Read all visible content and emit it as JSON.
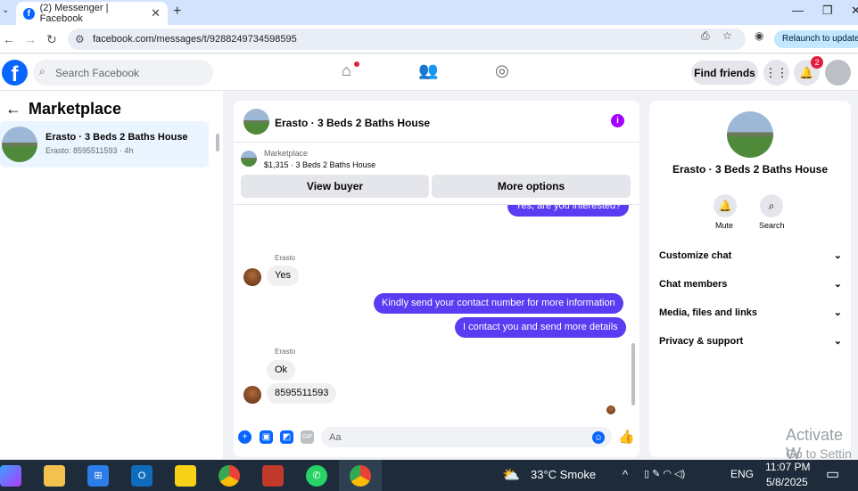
{
  "browser": {
    "tab_title": "(2) Messenger | Facebook",
    "url": "facebook.com/messages/t/9288249734598595",
    "relaunch_label": "Relaunch to update",
    "new_tab": "+",
    "close": "✕"
  },
  "fb": {
    "logo": "f",
    "search_placeholder": "Search Facebook",
    "find_friends": "Find friends",
    "notif_count": "2"
  },
  "left_panel": {
    "title": "Marketplace",
    "back_arrow": "←",
    "conversation": {
      "name": "Erasto · 3 Beds 2 Baths House",
      "subtitle": "Erasto: 8595511593 · 4h"
    }
  },
  "chat": {
    "title": "Erasto · 3 Beds 2 Baths House",
    "info": "i",
    "marketplace_label": "Marketplace",
    "listing": "$1,315 · 3 Beds 2 Baths House",
    "view_buyer": "View buyer",
    "more_options": "More options",
    "messages": {
      "top_cut": "Yes, are you interested?",
      "sender1": "Erasto",
      "m1": "Yes",
      "m2": "Kindly send your contact number for more information",
      "m3": "I contact you and send more details",
      "sender2": "Erasto",
      "m4": "Ok",
      "m5": "8595511593"
    },
    "composer_placeholder": "Aa",
    "composer_icons": [
      "plus-icon",
      "image-icon",
      "sticker-icon",
      "gif-icon",
      "emoji-icon",
      "like-icon"
    ]
  },
  "right_panel": {
    "name": "Erasto · 3 Beds 2 Baths House",
    "mute": "Mute",
    "search": "Search",
    "rows": [
      "Customize chat",
      "Chat members",
      "Media, files and links",
      "Privacy & support"
    ]
  },
  "watermark": {
    "line1": "Activate W",
    "line2": "Go to Settin"
  },
  "taskbar": {
    "weather": "33°C  Smoke",
    "lang": "ENG",
    "time": "11:07 PM",
    "date": "5/8/2025"
  },
  "colors": {
    "fb_blue": "#0866ff",
    "bubble_out": "#5b3cf2",
    "info": "#a200ff",
    "badge": "#e41e3f"
  }
}
